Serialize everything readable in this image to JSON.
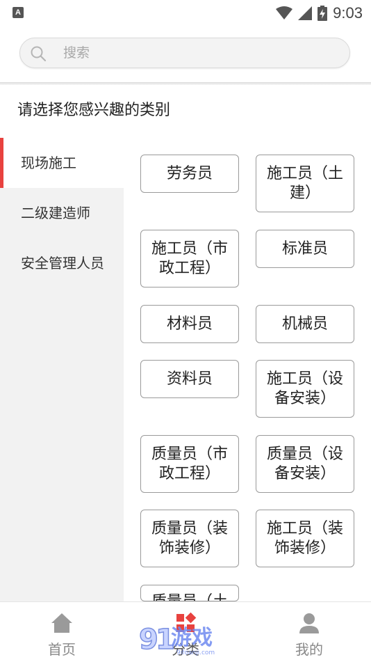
{
  "status_bar": {
    "time": "9:03",
    "app_icon_letter": "A"
  },
  "search": {
    "placeholder": "搜索"
  },
  "page_title": "请选择您感兴趣的类别",
  "sidebar": {
    "items": [
      {
        "label": "现场施工",
        "active": true
      },
      {
        "label": "二级建造师",
        "active": false
      },
      {
        "label": "安全管理人员",
        "active": false
      }
    ]
  },
  "categories": [
    {
      "label": "劳务员"
    },
    {
      "label": "施工员（土建）"
    },
    {
      "label": "施工员（市政工程）"
    },
    {
      "label": "标准员"
    },
    {
      "label": "材料员"
    },
    {
      "label": "机械员"
    },
    {
      "label": "资料员"
    },
    {
      "label": "施工员（设备安装）"
    },
    {
      "label": "质量员（市政工程）"
    },
    {
      "label": "质量员（设备安装）"
    },
    {
      "label": "质量员（装饰装修）"
    },
    {
      "label": "施工员（装饰装修）"
    },
    {
      "label": "质量员（土"
    }
  ],
  "bottom_nav": {
    "items": [
      {
        "label": "首页",
        "icon": "home-icon"
      },
      {
        "label": "分类",
        "icon": "category-icon",
        "active": true
      },
      {
        "label": "我的",
        "icon": "profile-icon"
      }
    ]
  },
  "watermark": {
    "text": "9游戏",
    "subtext": "9ifoanji.com"
  },
  "colors": {
    "accent": "#e8423f",
    "sidebar_bg": "#f2f2f2",
    "border": "#9a9a9a",
    "nav_label": "#888888"
  }
}
